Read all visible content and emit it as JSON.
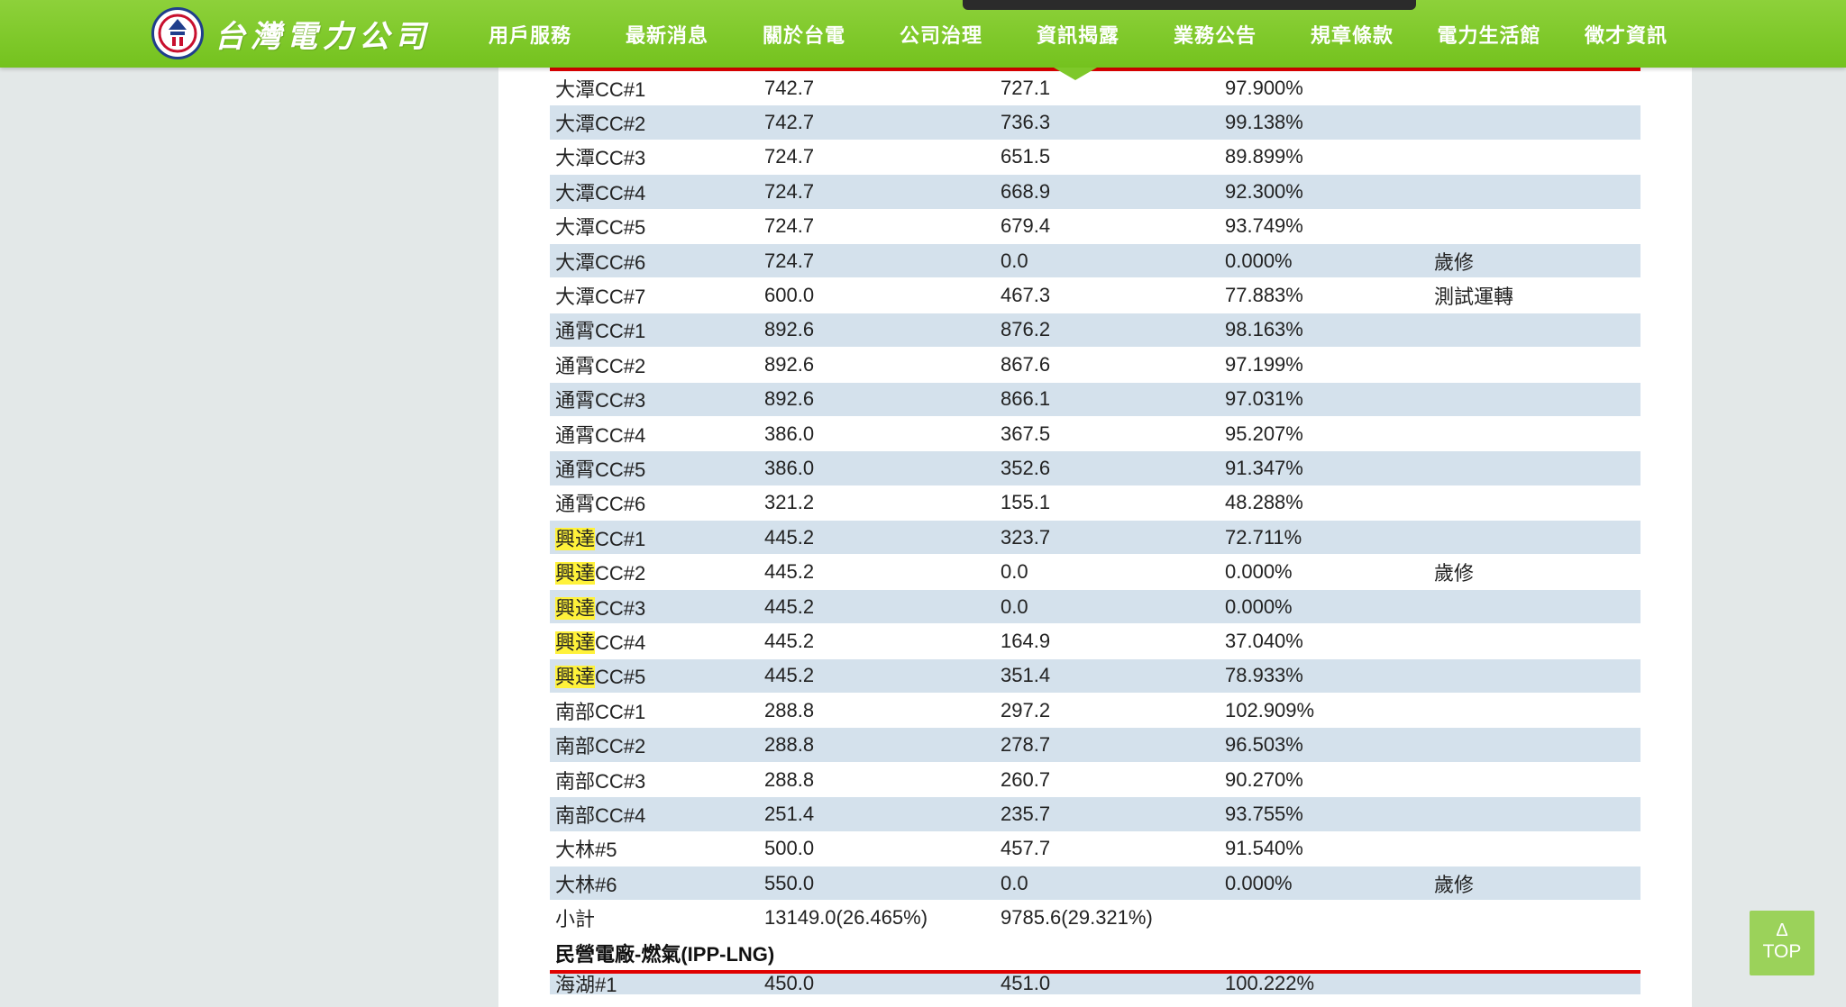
{
  "header": {
    "logo_text": "台灣電力公司",
    "nav": [
      "用戶服務",
      "最新消息",
      "關於台電",
      "公司治理",
      "資訊揭露",
      "業務公告",
      "規章條款",
      "電力生活館",
      "徵才資訊"
    ]
  },
  "table": {
    "rows": [
      {
        "prefix": "",
        "name": "大潭CC#1",
        "capacity": "742.7",
        "output": "727.1",
        "ratio": "97.900%",
        "note": ""
      },
      {
        "prefix": "",
        "name": "大潭CC#2",
        "capacity": "742.7",
        "output": "736.3",
        "ratio": "99.138%",
        "note": ""
      },
      {
        "prefix": "",
        "name": "大潭CC#3",
        "capacity": "724.7",
        "output": "651.5",
        "ratio": "89.899%",
        "note": ""
      },
      {
        "prefix": "",
        "name": "大潭CC#4",
        "capacity": "724.7",
        "output": "668.9",
        "ratio": "92.300%",
        "note": ""
      },
      {
        "prefix": "",
        "name": "大潭CC#5",
        "capacity": "724.7",
        "output": "679.4",
        "ratio": "93.749%",
        "note": ""
      },
      {
        "prefix": "",
        "name": "大潭CC#6",
        "capacity": "724.7",
        "output": "0.0",
        "ratio": "0.000%",
        "note": "歲修"
      },
      {
        "prefix": "",
        "name": "大潭CC#7",
        "capacity": "600.0",
        "output": "467.3",
        "ratio": "77.883%",
        "note": "測試運轉"
      },
      {
        "prefix": "",
        "name": "通霄CC#1",
        "capacity": "892.6",
        "output": "876.2",
        "ratio": "98.163%",
        "note": ""
      },
      {
        "prefix": "",
        "name": "通霄CC#2",
        "capacity": "892.6",
        "output": "867.6",
        "ratio": "97.199%",
        "note": ""
      },
      {
        "prefix": "",
        "name": "通霄CC#3",
        "capacity": "892.6",
        "output": "866.1",
        "ratio": "97.031%",
        "note": ""
      },
      {
        "prefix": "",
        "name": "通霄CC#4",
        "capacity": "386.0",
        "output": "367.5",
        "ratio": "95.207%",
        "note": ""
      },
      {
        "prefix": "",
        "name": "通霄CC#5",
        "capacity": "386.0",
        "output": "352.6",
        "ratio": "91.347%",
        "note": ""
      },
      {
        "prefix": "",
        "name": "通霄CC#6",
        "capacity": "321.2",
        "output": "155.1",
        "ratio": "48.288%",
        "note": ""
      },
      {
        "prefix": "興達",
        "name": "CC#1",
        "capacity": "445.2",
        "output": "323.7",
        "ratio": "72.711%",
        "note": ""
      },
      {
        "prefix": "興達",
        "name": "CC#2",
        "capacity": "445.2",
        "output": "0.0",
        "ratio": "0.000%",
        "note": "歲修"
      },
      {
        "prefix": "興達",
        "name": "CC#3",
        "capacity": "445.2",
        "output": "0.0",
        "ratio": "0.000%",
        "note": ""
      },
      {
        "prefix": "興達",
        "name": "CC#4",
        "capacity": "445.2",
        "output": "164.9",
        "ratio": "37.040%",
        "note": ""
      },
      {
        "prefix": "興達",
        "name": "CC#5",
        "capacity": "445.2",
        "output": "351.4",
        "ratio": "78.933%",
        "note": ""
      },
      {
        "prefix": "",
        "name": "南部CC#1",
        "capacity": "288.8",
        "output": "297.2",
        "ratio": "102.909%",
        "note": ""
      },
      {
        "prefix": "",
        "name": "南部CC#2",
        "capacity": "288.8",
        "output": "278.7",
        "ratio": "96.503%",
        "note": ""
      },
      {
        "prefix": "",
        "name": "南部CC#3",
        "capacity": "288.8",
        "output": "260.7",
        "ratio": "90.270%",
        "note": ""
      },
      {
        "prefix": "",
        "name": "南部CC#4",
        "capacity": "251.4",
        "output": "235.7",
        "ratio": "93.755%",
        "note": ""
      },
      {
        "prefix": "",
        "name": "大林#5",
        "capacity": "500.0",
        "output": "457.7",
        "ratio": "91.540%",
        "note": ""
      },
      {
        "prefix": "",
        "name": "大林#6",
        "capacity": "550.0",
        "output": "0.0",
        "ratio": "0.000%",
        "note": "歲修"
      },
      {
        "prefix": "",
        "name": "小計",
        "capacity": "13149.0(26.465%)",
        "output": "9785.6(29.321%)",
        "ratio": "",
        "note": ""
      }
    ],
    "section_heading": "民營電廠-燃氣(IPP-LNG)",
    "next_row": {
      "name": "海湖#1",
      "capacity": "450.0",
      "output": "451.0",
      "ratio": "100.222%"
    }
  },
  "top_button": {
    "arrow": "Δ",
    "label": "TOP"
  }
}
